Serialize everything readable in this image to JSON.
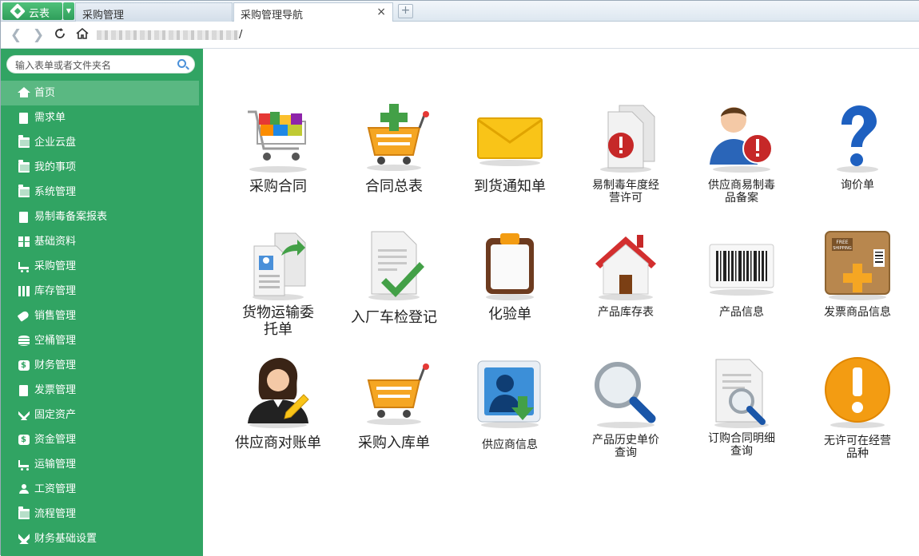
{
  "tabs": {
    "brand_label": "云表",
    "inactive_tab": "采购管理",
    "active_tab": "采购管理导航",
    "close_symbol": "×",
    "new_tab_symbol": "+"
  },
  "addressbar": {
    "url_suffix": "/"
  },
  "sidebar": {
    "search_placeholder": "输入表单或者文件夹名",
    "items": [
      {
        "label": "首页",
        "icon": "home-icon"
      },
      {
        "label": "需求单",
        "icon": "document-icon"
      },
      {
        "label": "企业云盘",
        "icon": "folder-icon"
      },
      {
        "label": "我的事项",
        "icon": "folder-icon"
      },
      {
        "label": "系统管理",
        "icon": "folder-icon"
      },
      {
        "label": "易制毒备案报表",
        "icon": "document-icon"
      },
      {
        "label": "基础资料",
        "icon": "grid-icon"
      },
      {
        "label": "采购管理",
        "icon": "cart-icon"
      },
      {
        "label": "库存管理",
        "icon": "warehouse-icon"
      },
      {
        "label": "销售管理",
        "icon": "tag-icon"
      },
      {
        "label": "空桶管理",
        "icon": "database-icon"
      },
      {
        "label": "财务管理",
        "icon": "coin-icon"
      },
      {
        "label": "发票管理",
        "icon": "invoice-icon"
      },
      {
        "label": "固定资产",
        "icon": "wrench-icon"
      },
      {
        "label": "资金管理",
        "icon": "coin-icon"
      },
      {
        "label": "运输管理",
        "icon": "cart-icon"
      },
      {
        "label": "工资管理",
        "icon": "users-icon"
      },
      {
        "label": "流程管理",
        "icon": "folder-icon"
      },
      {
        "label": "财务基础设置",
        "icon": "cross-tools-icon"
      }
    ]
  },
  "nav_tiles": [
    {
      "label": "采购合同",
      "icon": "shopping-cart-full-icon"
    },
    {
      "label": "合同总表",
      "icon": "cart-add-icon"
    },
    {
      "label": "到货通知单",
      "icon": "envelope-icon"
    },
    {
      "label": "易制毒年度经营许可",
      "line1": "易制毒年度经",
      "line2": "营许可",
      "icon": "document-warning-icon"
    },
    {
      "label": "供应商易制毒品备案",
      "line1": "供应商易制毒",
      "line2": "品备案",
      "icon": "user-warning-icon"
    },
    {
      "label": "询价单",
      "icon": "question-mark-icon"
    },
    {
      "label": "货物运输委托单",
      "line1": "货物运输委",
      "line2": "托单",
      "icon": "document-transfer-icon"
    },
    {
      "label": "入厂车检登记",
      "icon": "document-check-icon"
    },
    {
      "label": "化验单",
      "icon": "clipboard-icon"
    },
    {
      "label": "产品库存表",
      "icon": "house-icon"
    },
    {
      "label": "产品信息",
      "icon": "barcode-icon"
    },
    {
      "label": "发票商品信息",
      "icon": "box-add-icon"
    },
    {
      "label": "供应商对账单",
      "icon": "businesswoman-icon"
    },
    {
      "label": "采购入库单",
      "icon": "cart-icon"
    },
    {
      "label": "供应商信息",
      "icon": "contact-download-icon"
    },
    {
      "label": "产品历史单价查询",
      "line1": "产品历史单价",
      "line2": "查询",
      "icon": "magnifier-icon"
    },
    {
      "label": "订购合同明细查询",
      "line1": "订购合同明细",
      "line2": "查询",
      "icon": "document-search-icon"
    },
    {
      "label": "无许可在经营品种",
      "line1": "无许可在经营",
      "line2": "品种",
      "icon": "exclamation-icon"
    }
  ]
}
